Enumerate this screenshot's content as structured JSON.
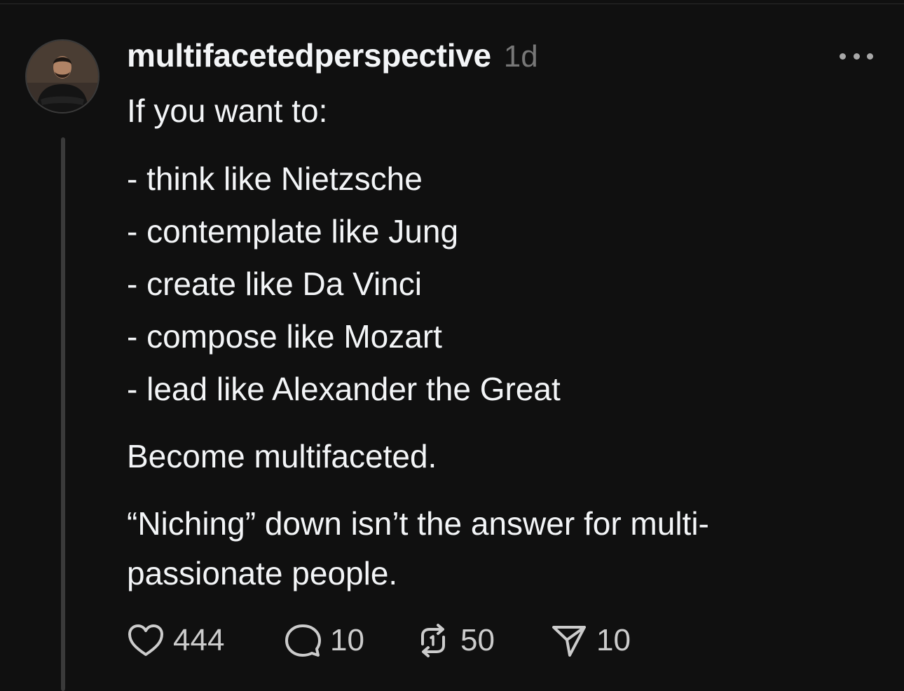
{
  "post": {
    "username": "multifacetedperspective",
    "timestamp": "1d",
    "intro": "If you want to:",
    "list": [
      "- think like Nietzsche",
      "- contemplate like Jung",
      "- create like Da Vinci",
      "- compose like Mozart",
      "- lead like Alexander the Great"
    ],
    "statement": "Become multifaceted.",
    "closing": "“Niching” down isn’t the answer for multi-passionate people."
  },
  "actions": {
    "likes": "444",
    "replies": "10",
    "reposts": "50",
    "shares": "10"
  },
  "icons": {
    "like": "heart-icon",
    "reply": "comment-bubble-icon",
    "repost": "repost-icon",
    "share": "send-icon",
    "more": "more-horizontal-icon"
  },
  "colors": {
    "background": "#101010",
    "text": "#f3f5f7",
    "muted": "#777777"
  }
}
